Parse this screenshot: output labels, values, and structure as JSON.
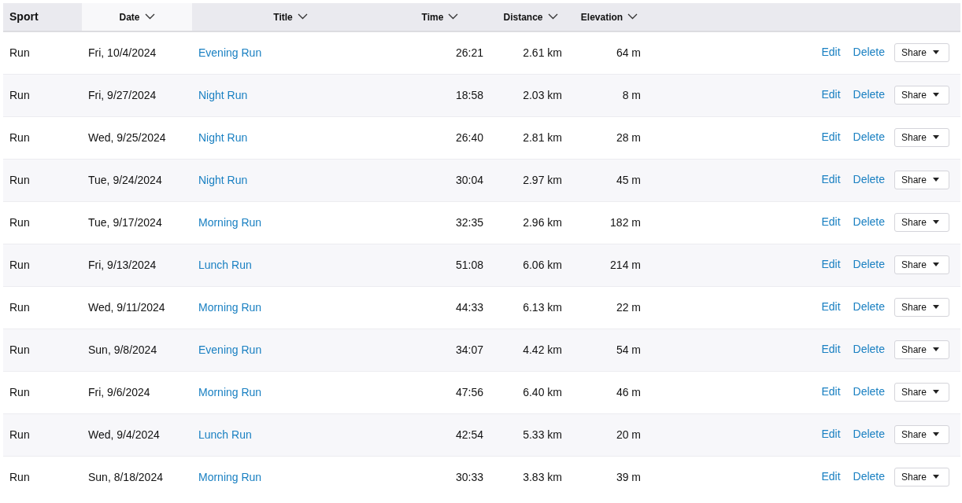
{
  "table": {
    "columns": [
      {
        "label": "Sport",
        "sortable": false,
        "sorted": false
      },
      {
        "label": "Date",
        "sortable": true,
        "sorted": true
      },
      {
        "label": "Title",
        "sortable": true,
        "sorted": false
      },
      {
        "label": "Time",
        "sortable": true,
        "sorted": false
      },
      {
        "label": "Distance",
        "sortable": true,
        "sorted": false
      },
      {
        "label": "Elevation",
        "sortable": true,
        "sorted": false
      }
    ],
    "rows": [
      {
        "sport": "Run",
        "date": "Fri, 10/4/2024",
        "title": "Evening Run",
        "time": "26:21",
        "distance": "2.61 km",
        "elevation": "64 m",
        "actions": [
          "Edit",
          "Delete"
        ],
        "share": "Share"
      },
      {
        "sport": "Run",
        "date": "Fri, 9/27/2024",
        "title": "Night Run",
        "time": "18:58",
        "distance": "2.03 km",
        "elevation": "8 m",
        "actions": [
          "Edit",
          "Delete"
        ],
        "share": "Share"
      },
      {
        "sport": "Run",
        "date": "Wed, 9/25/2024",
        "title": "Night Run",
        "time": "26:40",
        "distance": "2.81 km",
        "elevation": "28 m",
        "actions": [
          "Edit",
          "Delete"
        ],
        "share": "Share"
      },
      {
        "sport": "Run",
        "date": "Tue, 9/24/2024",
        "title": "Night Run",
        "time": "30:04",
        "distance": "2.97 km",
        "elevation": "45 m",
        "actions": [
          "Edit",
          "Delete"
        ],
        "share": "Share"
      },
      {
        "sport": "Run",
        "date": "Tue, 9/17/2024",
        "title": "Morning Run",
        "time": "32:35",
        "distance": "2.96 km",
        "elevation": "182 m",
        "actions": [
          "Edit",
          "Delete"
        ],
        "share": "Share"
      },
      {
        "sport": "Run",
        "date": "Fri, 9/13/2024",
        "title": "Lunch Run",
        "time": "51:08",
        "distance": "6.06 km",
        "elevation": "214 m",
        "actions": [
          "Edit",
          "Delete"
        ],
        "share": "Share"
      },
      {
        "sport": "Run",
        "date": "Wed, 9/11/2024",
        "title": "Morning Run",
        "time": "44:33",
        "distance": "6.13 km",
        "elevation": "22 m",
        "actions": [
          "Edit",
          "Delete"
        ],
        "share": "Share"
      },
      {
        "sport": "Run",
        "date": "Sun, 9/8/2024",
        "title": "Evening Run",
        "time": "34:07",
        "distance": "4.42 km",
        "elevation": "54 m",
        "actions": [
          "Edit",
          "Delete"
        ],
        "share": "Share"
      },
      {
        "sport": "Run",
        "date": "Fri, 9/6/2024",
        "title": "Morning Run",
        "time": "47:56",
        "distance": "6.40 km",
        "elevation": "46 m",
        "actions": [
          "Edit",
          "Delete"
        ],
        "share": "Share"
      },
      {
        "sport": "Run",
        "date": "Wed, 9/4/2024",
        "title": "Lunch Run",
        "time": "42:54",
        "distance": "5.33 km",
        "elevation": "20 m",
        "actions": [
          "Edit",
          "Delete"
        ],
        "share": "Share"
      },
      {
        "sport": "Run",
        "date": "Sun, 8/18/2024",
        "title": "Morning Run",
        "time": "30:33",
        "distance": "3.83 km",
        "elevation": "39 m",
        "actions": [
          "Edit",
          "Delete"
        ],
        "share": "Share"
      }
    ]
  }
}
